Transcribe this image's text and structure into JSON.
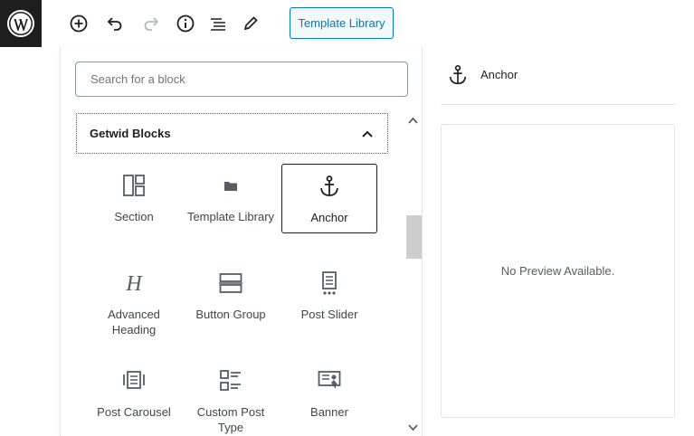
{
  "toolbar": {
    "logo_icon": "wordpress-logo-icon",
    "add_block_icon": "plus-circle-icon",
    "undo_icon": "undo-icon",
    "redo_icon": "redo-icon",
    "info_icon": "info-icon",
    "outline_icon": "list-view-icon",
    "tools_icon": "pencil-icon",
    "template_library_label": "Template Library"
  },
  "inserter": {
    "search_placeholder": "Search for a block",
    "group_title": "Getwid Blocks",
    "group_expanded": true,
    "blocks": [
      {
        "label": "Section",
        "icon": "section-icon",
        "selected": false
      },
      {
        "label": "Template Library",
        "icon": "folder-icon",
        "selected": false
      },
      {
        "label": "Anchor",
        "icon": "anchor-icon",
        "selected": true
      },
      {
        "label": "Advanced Heading",
        "icon": "heading-icon",
        "selected": false
      },
      {
        "label": "Button Group",
        "icon": "button-group-icon",
        "selected": false
      },
      {
        "label": "Post Slider",
        "icon": "post-slider-icon",
        "selected": false
      },
      {
        "label": "Post Carousel",
        "icon": "post-carousel-icon",
        "selected": false
      },
      {
        "label": "Custom Post Type",
        "icon": "custom-post-type-icon",
        "selected": false
      },
      {
        "label": "Banner",
        "icon": "banner-icon",
        "selected": false
      }
    ]
  },
  "preview": {
    "title": "Anchor",
    "icon": "anchor-icon",
    "empty_text": "No Preview Available."
  },
  "colors": {
    "accent": "#007cba",
    "dark": "#1e1e1e",
    "border": "#e2e4e7"
  }
}
